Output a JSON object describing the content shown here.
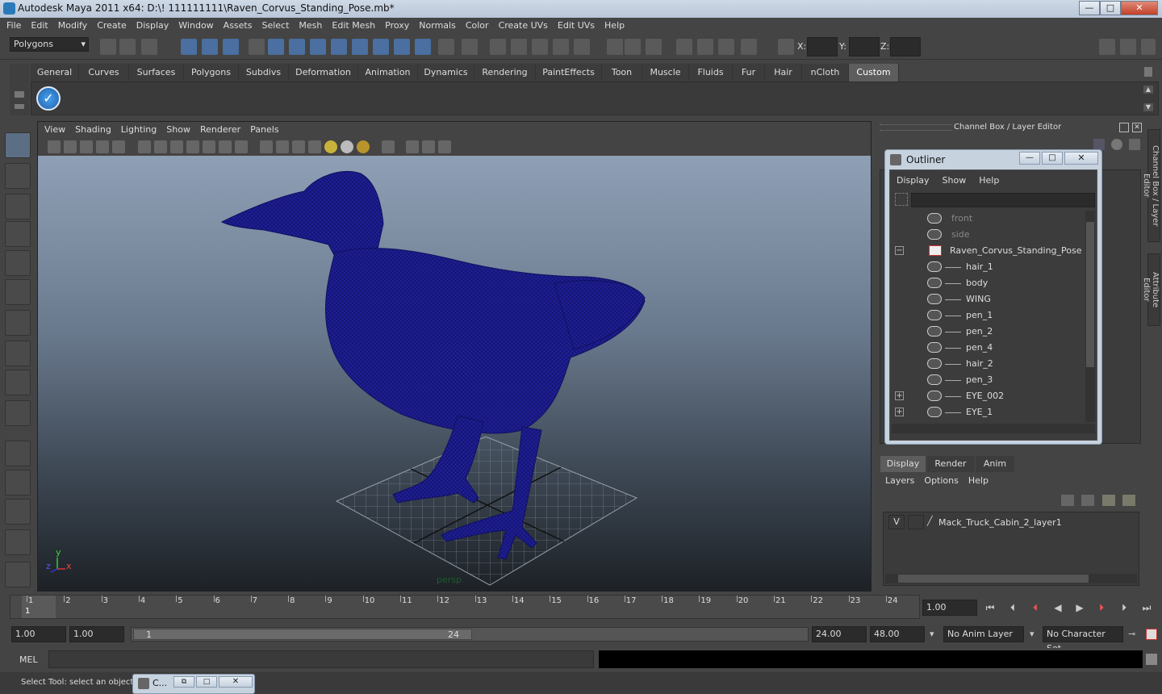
{
  "window": {
    "title": "Autodesk Maya 2011 x64: D:\\! 111111111\\Raven_Corvus_Standing_Pose.mb*",
    "buttons": [
      "—",
      "□",
      "✕"
    ]
  },
  "menubar": [
    "File",
    "Edit",
    "Modify",
    "Create",
    "Display",
    "Window",
    "Assets",
    "Select",
    "Mesh",
    "Edit Mesh",
    "Proxy",
    "Normals",
    "Color",
    "Create UVs",
    "Edit UVs",
    "Help"
  ],
  "statusline": {
    "mode": "Polygons",
    "x_label": "X:",
    "y_label": "Y:",
    "z_label": "Z:"
  },
  "shelf": {
    "tabs": [
      "General",
      "Curves",
      "Surfaces",
      "Polygons",
      "Subdivs",
      "Deformation",
      "Animation",
      "Dynamics",
      "Rendering",
      "PaintEffects",
      "Toon",
      "Muscle",
      "Fluids",
      "Fur",
      "Hair",
      "nCloth",
      "Custom"
    ],
    "active_tab": "Custom"
  },
  "viewport": {
    "menu": [
      "View",
      "Shading",
      "Lighting",
      "Show",
      "Renderer",
      "Panels"
    ],
    "camera_label": "persp",
    "axis_x": "x",
    "axis_y": "y",
    "axis_z": "z",
    "mesh_color": "#1a1a7a"
  },
  "channel_box": {
    "title": "Channel Box / Layer Editor",
    "side_tabs": [
      "Channel Box / Layer Editor",
      "Attribute Editor"
    ]
  },
  "outliner": {
    "title": "Outliner",
    "menu": [
      "Display",
      "Show",
      "Help"
    ],
    "items": [
      {
        "label": "front",
        "dim": true
      },
      {
        "label": "side",
        "dim": true
      },
      {
        "label": "Raven_Corvus_Standing_Pose",
        "dim": false
      },
      {
        "label": "hair_1",
        "dim": false
      },
      {
        "label": "body",
        "dim": false
      },
      {
        "label": "WING",
        "dim": false
      },
      {
        "label": "pen_1",
        "dim": false
      },
      {
        "label": "pen_2",
        "dim": false
      },
      {
        "label": "pen_4",
        "dim": false
      },
      {
        "label": "hair_2",
        "dim": false
      },
      {
        "label": "pen_3",
        "dim": false
      },
      {
        "label": "EYE_002",
        "dim": false
      },
      {
        "label": "EYE_1",
        "dim": false
      }
    ]
  },
  "layer_editor": {
    "tabs": [
      "Display",
      "Render",
      "Anim"
    ],
    "active_tab": "Display",
    "menu": [
      "Layers",
      "Options",
      "Help"
    ],
    "layer": {
      "visible": "V",
      "name": "Mack_Truck_Cabin_2_layer1"
    }
  },
  "timeline": {
    "ticks": [
      "1",
      "2",
      "3",
      "4",
      "5",
      "6",
      "7",
      "8",
      "9",
      "10",
      "11",
      "12",
      "13",
      "14",
      "15",
      "16",
      "17",
      "18",
      "19",
      "20",
      "21",
      "22",
      "23",
      "24"
    ],
    "current_frame_marker": "1",
    "current_time": "1.00"
  },
  "range": {
    "start_outer": "1.00",
    "start_inner": "1.00",
    "slider_start": "1",
    "slider_end": "24",
    "end_inner": "24.00",
    "end_outer": "48.00",
    "anim_layer": "No Anim Layer",
    "character_set": "No Character Set"
  },
  "cmdline": {
    "label": "MEL"
  },
  "helpline": {
    "text": "Select Tool: select an object"
  },
  "taskbar": {
    "label": "C..."
  }
}
